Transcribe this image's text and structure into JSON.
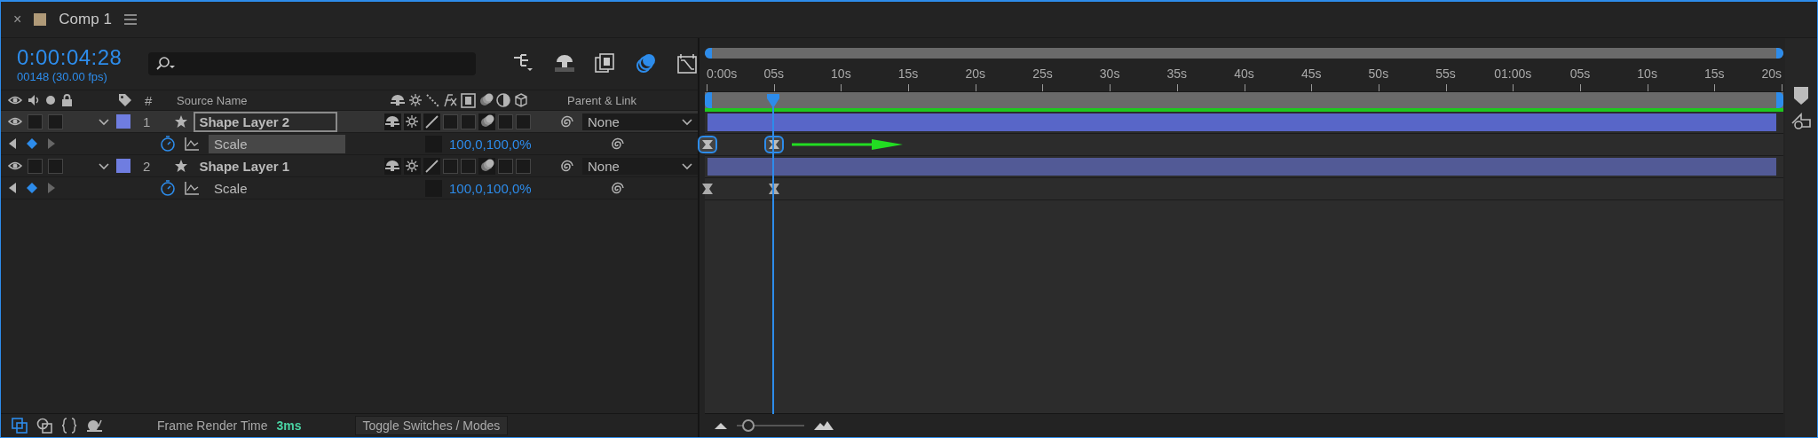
{
  "tab": {
    "close": "×",
    "title": "Comp 1",
    "color": "#b09a78"
  },
  "timecode": "0:00:04:28",
  "frame_info": "00148 (30.00 fps)",
  "toolbar": [
    {
      "kind": "hierarchy",
      "on": false
    },
    {
      "kind": "shy",
      "on": false
    },
    {
      "kind": "frameblend",
      "on": false
    },
    {
      "kind": "motionblur",
      "on": true
    },
    {
      "kind": "graph",
      "on": false
    }
  ],
  "columns": {
    "number": "#",
    "source": "Source Name",
    "parent": "Parent & Link"
  },
  "layers": [
    {
      "number": "1",
      "name": "Shape Layer 2",
      "selected": true,
      "expanded": true,
      "color": "#6f7de0",
      "parent": "None",
      "property": {
        "name": "Scale",
        "value": "100,0,100,0%",
        "selected": true,
        "keyframes": [
          {
            "level": 0,
            "selected": true
          },
          {
            "level": 0.062,
            "selected": true
          }
        ]
      }
    },
    {
      "number": "2",
      "name": "Shape Layer 1",
      "selected": false,
      "expanded": true,
      "color": "#6f7de0",
      "parent": "None",
      "property": {
        "name": "Scale",
        "value": "100,0,100,0%",
        "selected": false,
        "keyframes": [
          {
            "level": 0,
            "selected": false
          },
          {
            "level": 0.062,
            "selected": false
          }
        ]
      }
    }
  ],
  "ruler": [
    "0:00s",
    "05s",
    "10s",
    "15s",
    "20s",
    "25s",
    "30s",
    "35s",
    "40s",
    "45s",
    "50s",
    "55s",
    "01:00s",
    "05s",
    "10s",
    "15s",
    "20s"
  ],
  "playhead": {
    "level": 0.062
  },
  "status": {
    "label": "Frame Render Time",
    "value": "3ms",
    "toggle": "Toggle Switches / Modes"
  },
  "zoom": {
    "level": 0.08
  }
}
